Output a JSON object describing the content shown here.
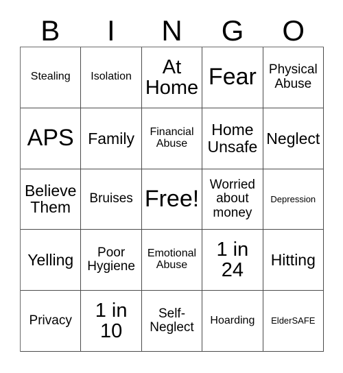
{
  "card": {
    "header_letters": [
      "B",
      "I",
      "N",
      "G",
      "O"
    ],
    "free_space_label": "Free!",
    "rows": [
      [
        {
          "label": "Stealing",
          "size": "sm"
        },
        {
          "label": "Isolation",
          "size": "sm"
        },
        {
          "label": "At Home",
          "size": "xl"
        },
        {
          "label": "Fear",
          "size": "xxl"
        },
        {
          "label": "Physical Abuse",
          "size": "md"
        }
      ],
      [
        {
          "label": "APS",
          "size": "xxl"
        },
        {
          "label": "Family",
          "size": "lg"
        },
        {
          "label": "Financial Abuse",
          "size": "sm"
        },
        {
          "label": "Home Unsafe",
          "size": "lg"
        },
        {
          "label": "Neglect",
          "size": "lg"
        }
      ],
      [
        {
          "label": "Believe Them",
          "size": "lg"
        },
        {
          "label": "Bruises",
          "size": "md"
        },
        {
          "label": "Free!",
          "size": "xxl"
        },
        {
          "label": "Worried about money",
          "size": "md"
        },
        {
          "label": "Depression",
          "size": "xs"
        }
      ],
      [
        {
          "label": "Yelling",
          "size": "lg"
        },
        {
          "label": "Poor Hygiene",
          "size": "md"
        },
        {
          "label": "Emotional Abuse",
          "size": "sm"
        },
        {
          "label": "1 in 24",
          "size": "xl"
        },
        {
          "label": "Hitting",
          "size": "lg"
        }
      ],
      [
        {
          "label": "Privacy",
          "size": "md"
        },
        {
          "label": "1 in 10",
          "size": "xl"
        },
        {
          "label": "Self-Neglect",
          "size": "md"
        },
        {
          "label": "Hoarding",
          "size": "sm"
        },
        {
          "label": "ElderSAFE",
          "size": "xs"
        }
      ]
    ]
  },
  "colors": {
    "background": "#ffffff",
    "text": "#000000",
    "grid_line": "#4a4a4a"
  }
}
